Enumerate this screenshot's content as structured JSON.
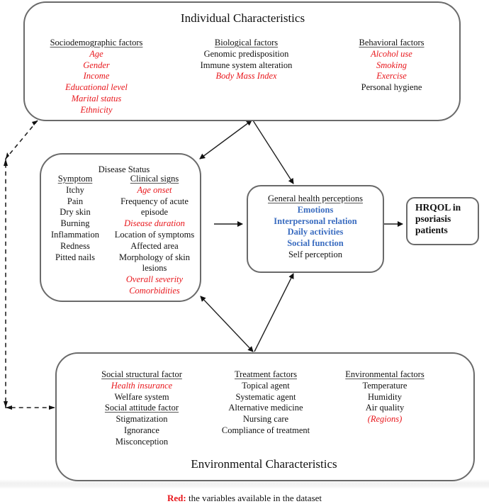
{
  "legend_colors": {
    "red": "#e8161b",
    "blue": "#3a6cc0",
    "black": "#111111"
  },
  "individual": {
    "title": "Individual Characteristics",
    "sociodemographic": {
      "header": "Sociodemographic factors",
      "items": [
        {
          "text": "Age",
          "style": "red"
        },
        {
          "text": "Gender",
          "style": "red"
        },
        {
          "text": "Income",
          "style": "red"
        },
        {
          "text": "Educational level",
          "style": "red"
        },
        {
          "text": "Marital status",
          "style": "red"
        },
        {
          "text": "Ethnicity",
          "style": "red"
        }
      ]
    },
    "biological": {
      "header": "Biological factors",
      "items": [
        {
          "text": "Genomic predisposition",
          "style": "blk"
        },
        {
          "text": "Immune system alteration",
          "style": "blk"
        },
        {
          "text": "Body Mass Index",
          "style": "red"
        }
      ]
    },
    "behavioral": {
      "header": "Behavioral factors",
      "items": [
        {
          "text": "Alcohol use",
          "style": "red"
        },
        {
          "text": "Smoking",
          "style": "red"
        },
        {
          "text": "Exercise",
          "style": "red"
        },
        {
          "text": "Personal hygiene",
          "style": "blk"
        }
      ]
    }
  },
  "disease": {
    "title": "Disease Status",
    "symptom": {
      "header": "Symptom",
      "items": [
        {
          "text": "Itchy",
          "style": "blk"
        },
        {
          "text": "Pain",
          "style": "blk"
        },
        {
          "text": "Dry skin",
          "style": "blk"
        },
        {
          "text": "Burning",
          "style": "blk"
        },
        {
          "text": "Inflammation",
          "style": "blk"
        },
        {
          "text": "Redness",
          "style": "blk"
        },
        {
          "text": "Pitted nails",
          "style": "blk"
        }
      ]
    },
    "clinical": {
      "header": "Clinical signs",
      "items": [
        {
          "text": "Age onset",
          "style": "red"
        },
        {
          "text": "Frequency of acute",
          "style": "blk"
        },
        {
          "text": "episode",
          "style": "blk"
        },
        {
          "text": "Disease duration",
          "style": "red"
        },
        {
          "text": "Location of symptoms",
          "style": "blk"
        },
        {
          "text": "Affected area",
          "style": "blk"
        },
        {
          "text": "Morphology of skin",
          "style": "blk"
        },
        {
          "text": "lesions",
          "style": "blk"
        },
        {
          "text": "Overall severity",
          "style": "red"
        },
        {
          "text": "Comorbidities",
          "style": "red"
        }
      ]
    }
  },
  "health": {
    "header": "General health perceptions",
    "items": [
      {
        "text": "Emotions",
        "style": "blue"
      },
      {
        "text": "Interpersonal relation",
        "style": "blue"
      },
      {
        "text": "Daily activities",
        "style": "blue"
      },
      {
        "text": "Social function",
        "style": "blue"
      },
      {
        "text": "Self perception",
        "style": "blk"
      }
    ]
  },
  "outcome": {
    "lines": [
      "HRQOL in",
      "psoriasis",
      "patients"
    ]
  },
  "environmental": {
    "title": "Environmental Characteristics",
    "social": {
      "header": "Social structural factor",
      "items": [
        {
          "text": "Health insurance",
          "style": "red"
        },
        {
          "text": "Welfare system",
          "style": "blk"
        }
      ]
    },
    "attitude": {
      "header": "Social attitude factor",
      "items": [
        {
          "text": "Stigmatization",
          "style": "blk"
        },
        {
          "text": "Ignorance",
          "style": "blk"
        },
        {
          "text": "Misconception",
          "style": "blk"
        }
      ]
    },
    "treatment": {
      "header": "Treatment factors",
      "items": [
        {
          "text": "Topical agent",
          "style": "blk"
        },
        {
          "text": "Systematic agent",
          "style": "blk"
        },
        {
          "text": "Alternative medicine",
          "style": "blk"
        },
        {
          "text": "Nursing care",
          "style": "blk"
        },
        {
          "text": "Compliance of treatment",
          "style": "blk"
        }
      ]
    },
    "envfactors": {
      "header": "Environmental factors",
      "items": [
        {
          "text": "Temperature",
          "style": "blk"
        },
        {
          "text": "Humidity",
          "style": "blk"
        },
        {
          "text": "Air quality",
          "style": "blk"
        },
        {
          "text": "(Regions)",
          "style": "red"
        }
      ]
    }
  },
  "caption": {
    "highlight": "Red:",
    "rest": " the variables available in the dataset"
  }
}
